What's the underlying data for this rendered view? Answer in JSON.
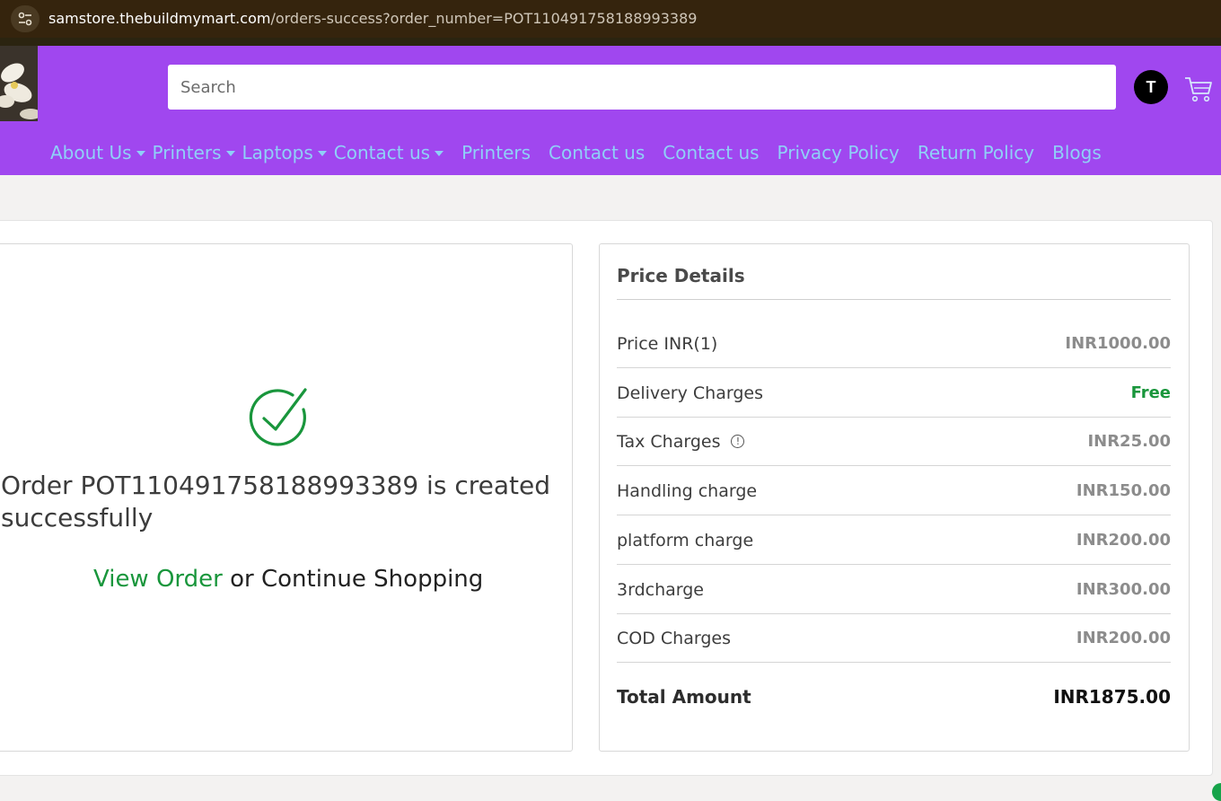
{
  "browser": {
    "url_domain": "samstore.thebuildmymart.com",
    "url_path": "/orders-success?order_number=POT110491758188993389"
  },
  "header": {
    "search_placeholder": "Search",
    "avatar_initial": "T"
  },
  "nav": {
    "items": [
      {
        "label": "About Us",
        "dropdown": true
      },
      {
        "label": "Printers",
        "dropdown": true
      },
      {
        "label": "Laptops",
        "dropdown": true
      },
      {
        "label": "Contact us",
        "dropdown": true
      },
      {
        "label": "Printers",
        "dropdown": false
      },
      {
        "label": "Contact us",
        "dropdown": false
      },
      {
        "label": "Contact us",
        "dropdown": false
      },
      {
        "label": "Privacy Policy",
        "dropdown": false
      },
      {
        "label": "Return Policy",
        "dropdown": false
      },
      {
        "label": "Blogs",
        "dropdown": false
      }
    ]
  },
  "order": {
    "message": "Order POT110491758188993389 is created successfully",
    "view_order": "View Order",
    "or": "or",
    "continue_shopping": "Continue Shopping"
  },
  "price_details": {
    "title": "Price Details",
    "rows": [
      {
        "label": "Price INR(1)",
        "value": "INR1000.00"
      },
      {
        "label": "Delivery Charges",
        "value": "Free"
      },
      {
        "label": "Tax Charges",
        "value": "INR25.00"
      },
      {
        "label": "Handling charge",
        "value": "INR150.00"
      },
      {
        "label": "platform charge",
        "value": "INR200.00"
      },
      {
        "label": "3rdcharge",
        "value": "INR300.00"
      },
      {
        "label": "COD Charges",
        "value": "INR200.00"
      }
    ],
    "total_label": "Total Amount",
    "total_value": "INR1875.00"
  },
  "colors": {
    "header_bg": "#a047ef",
    "nav_link": "#8fd0f7",
    "success_green": "#19963c",
    "address_bar": "#35240d"
  }
}
